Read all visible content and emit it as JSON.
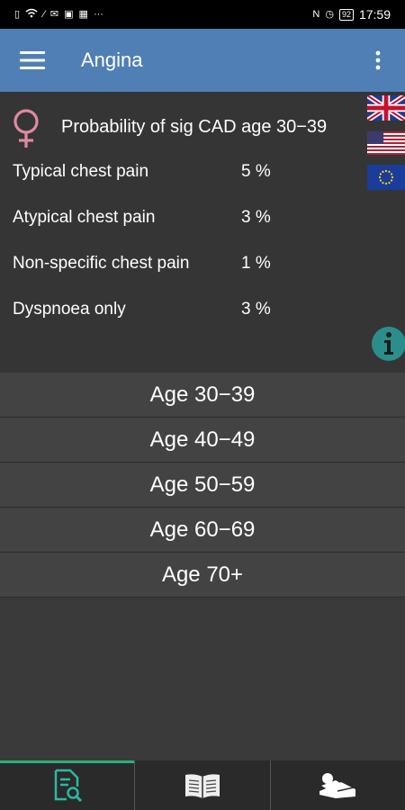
{
  "status_bar": {
    "time": "17:59",
    "battery": "92",
    "left_icons": [
      "sim-icon",
      "wifi-icon",
      "data-icon",
      "notification-icon",
      "gallery-icon",
      "app-icon",
      "more-icon"
    ],
    "right_icons": [
      "nfc-icon",
      "alarm-icon",
      "battery-icon"
    ]
  },
  "app_bar": {
    "title": "Angina",
    "color": "#4f7fb4"
  },
  "result": {
    "title": "Probability of sig CAD age 30−39",
    "gender_icon": "female-symbol-icon",
    "gender_color": "#e08a9e",
    "rows": [
      {
        "label": "Typical chest pain",
        "value": "5 %"
      },
      {
        "label": "Atypical chest pain",
        "value": "3 %"
      },
      {
        "label": "Non-specific chest pain",
        "value": "1 %"
      },
      {
        "label": "Dyspnoea only",
        "value": "3 %"
      }
    ]
  },
  "flags": [
    "uk-flag-icon",
    "us-flag-icon",
    "eu-flag-icon"
  ],
  "age_options": [
    {
      "label": "Age 30−39"
    },
    {
      "label": "Age 40−49"
    },
    {
      "label": "Age 50−59"
    },
    {
      "label": "Age 60−69"
    },
    {
      "label": "Age 70+"
    }
  ],
  "bottom_nav": {
    "active_color": "#2bb07a",
    "tabs": [
      {
        "icon": "document-search-icon",
        "active": true
      },
      {
        "icon": "book-icon",
        "active": false
      },
      {
        "icon": "patient-bed-icon",
        "active": false
      }
    ]
  }
}
